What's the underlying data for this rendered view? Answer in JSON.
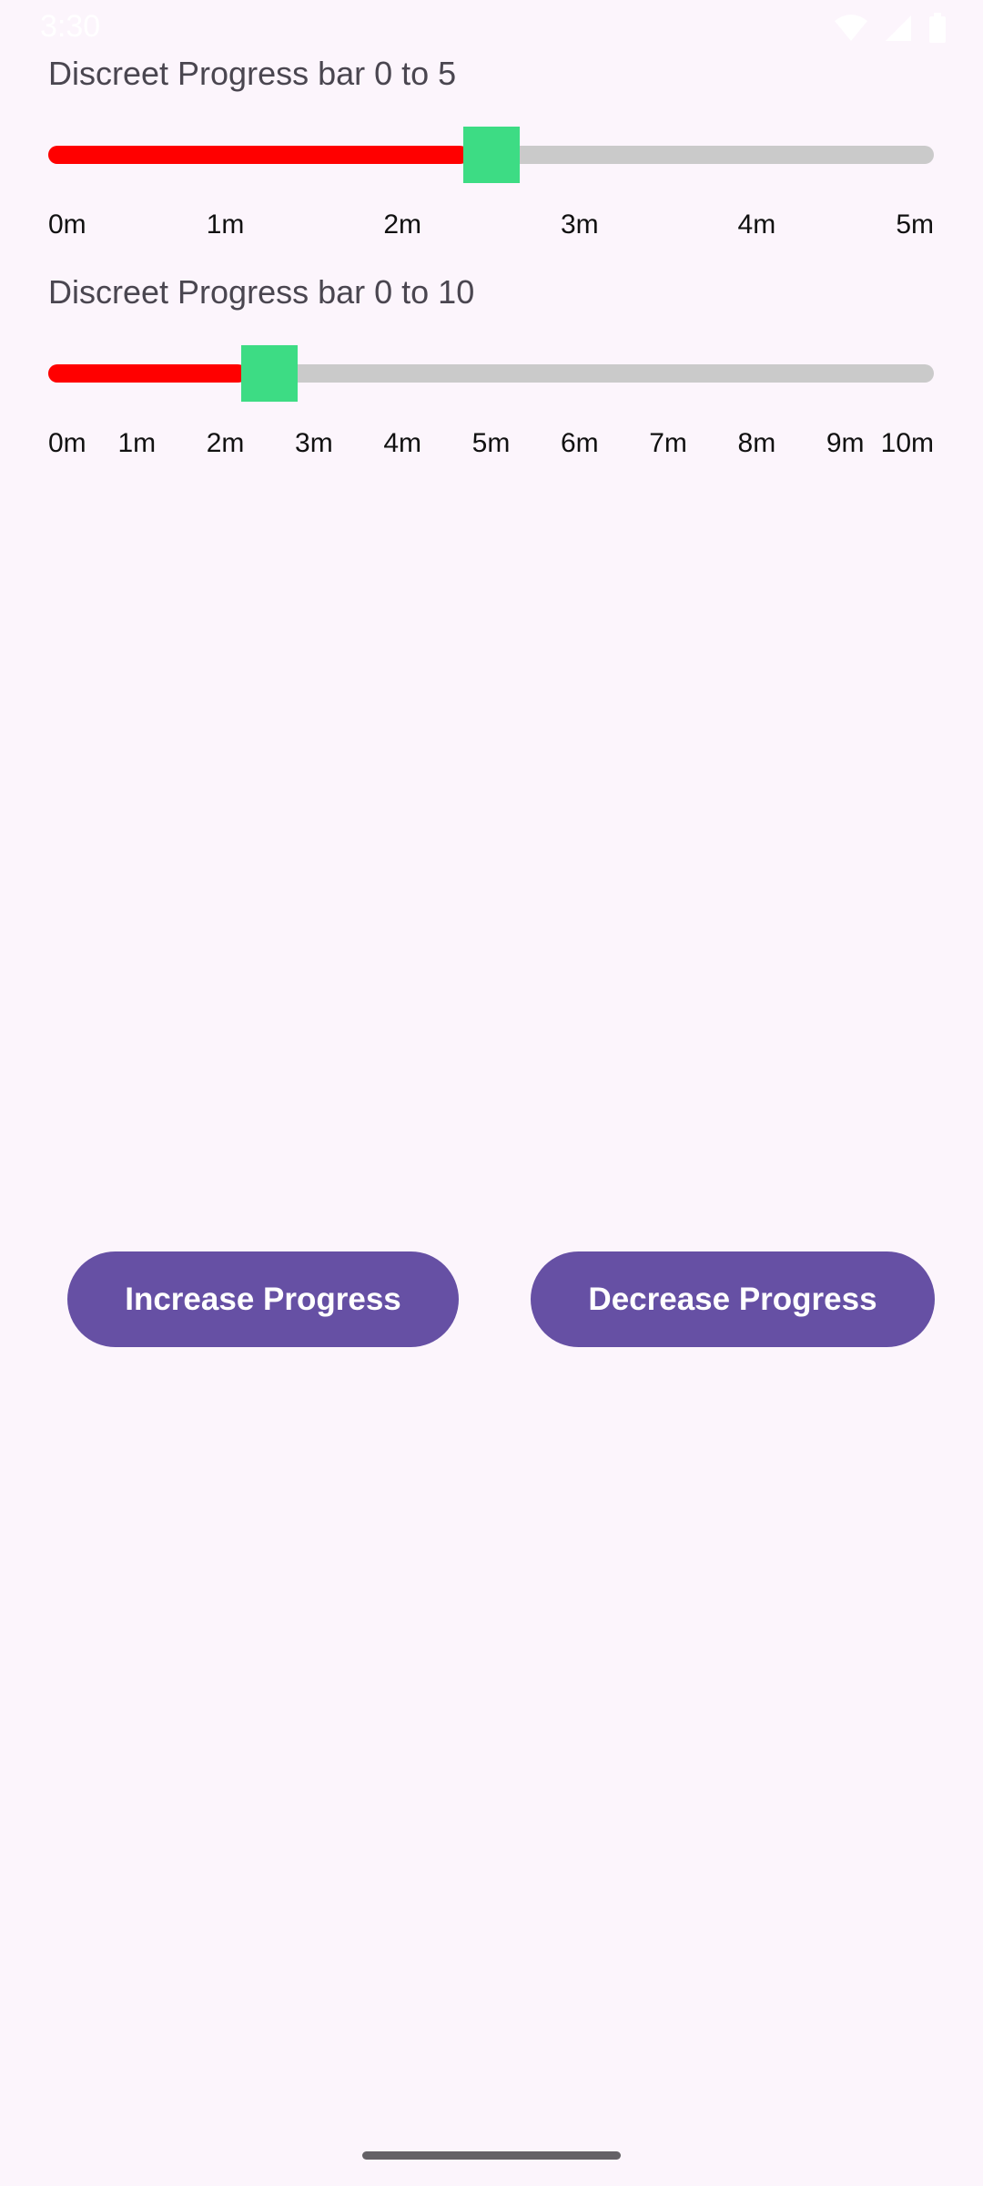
{
  "status_bar": {
    "time": "3:30",
    "icons": [
      "wifi-icon",
      "signal-icon",
      "battery-icon"
    ]
  },
  "sliders": [
    {
      "label": "Discreet Progress bar 0 to 5",
      "min": 0,
      "max": 5,
      "value": 2.5,
      "ticks": [
        "0m",
        "1m",
        "2m",
        "3m",
        "4m",
        "5m"
      ]
    },
    {
      "label": "Discreet Progress bar 0 to 10",
      "min": 0,
      "max": 10,
      "value": 2.5,
      "ticks": [
        "0m",
        "1m",
        "2m",
        "3m",
        "4m",
        "5m",
        "6m",
        "7m",
        "8m",
        "9m",
        "10m"
      ]
    }
  ],
  "buttons": {
    "increase_label": "Increase Progress",
    "decrease_label": "Decrease Progress"
  },
  "colors": {
    "background": "#FCF5FC",
    "progress_fill": "#FF0000",
    "track": "#CACACA",
    "thumb": "#3DDC84",
    "button": "#6650A4"
  }
}
